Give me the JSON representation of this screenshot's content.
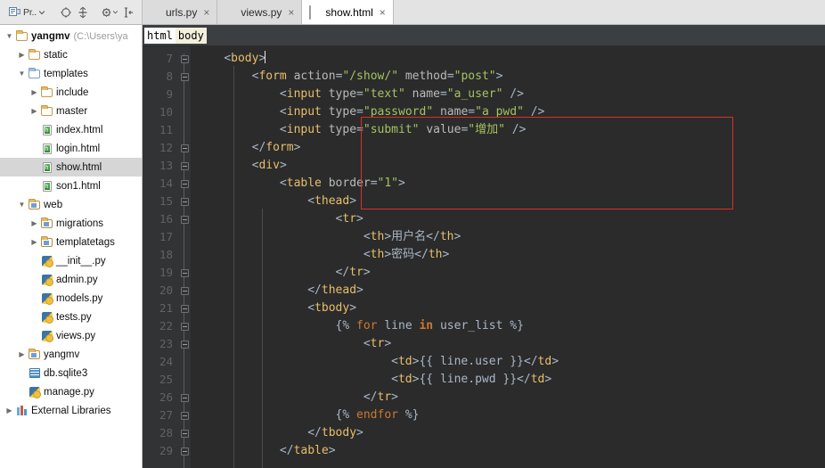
{
  "toolbar": {
    "project_label": "Pr..",
    "buttons": [
      {
        "name": "project-selector",
        "icon": "project-icon",
        "label": "Pr.."
      },
      {
        "name": "sync-button",
        "icon": "sync-icon",
        "label": ""
      },
      {
        "name": "collapse-all-button",
        "icon": "collapse-all-icon",
        "label": ""
      },
      {
        "name": "settings-button",
        "icon": "gear-icon",
        "label": ""
      },
      {
        "name": "scroll-from-source-button",
        "icon": "target-icon",
        "label": ""
      }
    ]
  },
  "tabs": [
    {
      "label": "urls.py",
      "icon": "python-file-icon",
      "active": false,
      "close": "×"
    },
    {
      "label": "views.py",
      "icon": "python-file-icon",
      "active": false,
      "close": "×"
    },
    {
      "label": "show.html",
      "icon": "html-file-icon",
      "active": true,
      "close": "×"
    }
  ],
  "tree": [
    {
      "depth": 0,
      "arrow": "▼",
      "icon": "folder",
      "label": "yangmv",
      "bold": true,
      "sub": "(C:\\Users\\ya",
      "selected": false
    },
    {
      "depth": 1,
      "arrow": "▶",
      "icon": "folder",
      "label": "static",
      "bold": false,
      "sub": "",
      "selected": false
    },
    {
      "depth": 1,
      "arrow": "▼",
      "icon": "folder-blue",
      "label": "templates",
      "bold": false,
      "sub": "",
      "selected": false
    },
    {
      "depth": 2,
      "arrow": "▶",
      "icon": "folder",
      "label": "include",
      "bold": false,
      "sub": "",
      "selected": false
    },
    {
      "depth": 2,
      "arrow": "▶",
      "icon": "folder",
      "label": "master",
      "bold": false,
      "sub": "",
      "selected": false
    },
    {
      "depth": 2,
      "arrow": "",
      "icon": "html-file",
      "label": "index.html",
      "bold": false,
      "sub": "",
      "selected": false
    },
    {
      "depth": 2,
      "arrow": "",
      "icon": "html-file",
      "label": "login.html",
      "bold": false,
      "sub": "",
      "selected": false
    },
    {
      "depth": 2,
      "arrow": "",
      "icon": "html-file",
      "label": "show.html",
      "bold": false,
      "sub": "",
      "selected": true
    },
    {
      "depth": 2,
      "arrow": "",
      "icon": "html-file",
      "label": "son1.html",
      "bold": false,
      "sub": "",
      "selected": false
    },
    {
      "depth": 1,
      "arrow": "▼",
      "icon": "folder-module",
      "label": "web",
      "bold": false,
      "sub": "",
      "selected": false
    },
    {
      "depth": 2,
      "arrow": "▶",
      "icon": "folder-module",
      "label": "migrations",
      "bold": false,
      "sub": "",
      "selected": false
    },
    {
      "depth": 2,
      "arrow": "▶",
      "icon": "folder-module",
      "label": "templatetags",
      "bold": false,
      "sub": "",
      "selected": false
    },
    {
      "depth": 2,
      "arrow": "",
      "icon": "python-file",
      "label": "__init__.py",
      "bold": false,
      "sub": "",
      "selected": false
    },
    {
      "depth": 2,
      "arrow": "",
      "icon": "python-file",
      "label": "admin.py",
      "bold": false,
      "sub": "",
      "selected": false
    },
    {
      "depth": 2,
      "arrow": "",
      "icon": "python-file",
      "label": "models.py",
      "bold": false,
      "sub": "",
      "selected": false
    },
    {
      "depth": 2,
      "arrow": "",
      "icon": "python-file",
      "label": "tests.py",
      "bold": false,
      "sub": "",
      "selected": false
    },
    {
      "depth": 2,
      "arrow": "",
      "icon": "python-file",
      "label": "views.py",
      "bold": false,
      "sub": "",
      "selected": false
    },
    {
      "depth": 1,
      "arrow": "▶",
      "icon": "folder-module",
      "label": "yangmv",
      "bold": false,
      "sub": "",
      "selected": false
    },
    {
      "depth": 1,
      "arrow": "",
      "icon": "db-file",
      "label": "db.sqlite3",
      "bold": false,
      "sub": "",
      "selected": false
    },
    {
      "depth": 1,
      "arrow": "",
      "icon": "python-file",
      "label": "manage.py",
      "bold": false,
      "sub": "",
      "selected": false
    },
    {
      "depth": 0,
      "arrow": "▶",
      "icon": "libraries",
      "label": "External Libraries",
      "bold": false,
      "sub": "",
      "selected": false
    }
  ],
  "breadcrumb": {
    "items": [
      "html",
      "body"
    ]
  },
  "editor": {
    "first_line": 7,
    "line_numbers": [
      7,
      8,
      9,
      10,
      11,
      12,
      13,
      14,
      15,
      16,
      17,
      18,
      19,
      20,
      21,
      22,
      23,
      24,
      25,
      26,
      27,
      28,
      29
    ],
    "lines": [
      {
        "n": 7,
        "text": "    <body>",
        "caret": true
      },
      {
        "n": 8,
        "text": "        <form action=\"/show/\" method=\"post\">"
      },
      {
        "n": 9,
        "text": "            <input type=\"text\" name=\"a_user\" />"
      },
      {
        "n": 10,
        "text": "            <input type=\"password\" name=\"a_pwd\" />"
      },
      {
        "n": 11,
        "text": "            <input type=\"submit\" value=\"增加\" />"
      },
      {
        "n": 12,
        "text": "        </form>"
      },
      {
        "n": 13,
        "text": "        <div>"
      },
      {
        "n": 14,
        "text": "            <table border=\"1\">"
      },
      {
        "n": 15,
        "text": "                <thead>"
      },
      {
        "n": 16,
        "text": "                    <tr>"
      },
      {
        "n": 17,
        "text": "                        <th>用户名</th>"
      },
      {
        "n": 18,
        "text": "                        <th>密码</th>"
      },
      {
        "n": 19,
        "text": "                    </tr>"
      },
      {
        "n": 20,
        "text": "                </thead>"
      },
      {
        "n": 21,
        "text": "                <tbody>"
      },
      {
        "n": 22,
        "text": "                    {% for line in user_list %}"
      },
      {
        "n": 23,
        "text": "                        <tr>"
      },
      {
        "n": 24,
        "text": "                            <td>{{ line.user }}</td>"
      },
      {
        "n": 25,
        "text": "                            <td>{{ line.pwd }}</td>"
      },
      {
        "n": 26,
        "text": "                        </tr>"
      },
      {
        "n": 27,
        "text": "                    {% endfor %}"
      },
      {
        "n": 28,
        "text": "                </tbody>"
      },
      {
        "n": 29,
        "text": "            </table>"
      }
    ],
    "fold_lines": [
      7,
      8,
      12,
      13,
      14,
      15,
      16,
      19,
      20,
      21,
      22,
      23,
      26,
      27,
      28,
      29
    ]
  },
  "annotation": {
    "name": "red-highlight-box",
    "color": "#d93025",
    "covers_lines": [
      8,
      9,
      10,
      11,
      12
    ]
  },
  "colors": {
    "editor_bg": "#2b2b2b",
    "gutter_bg": "#313335",
    "tag": "#e8bf6a",
    "attr_value": "#a5c261",
    "keyword": "#cc7832",
    "text": "#a9b7c6",
    "annotation_red": "#d93025",
    "tree_bg": "#ffffff",
    "selected_row": "#d6d6d6"
  }
}
